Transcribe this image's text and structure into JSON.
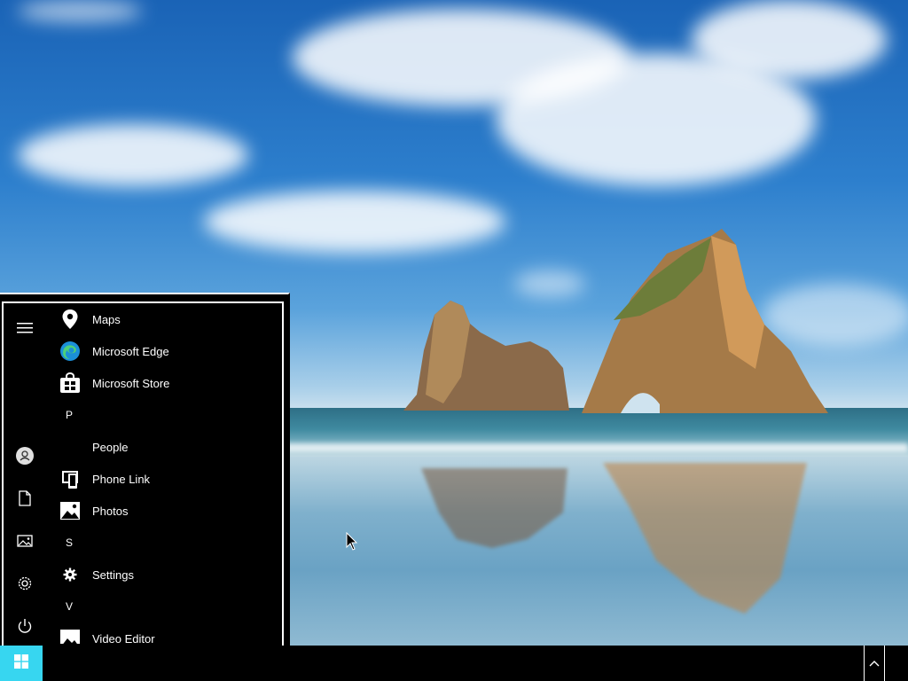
{
  "start_menu": {
    "rail": [
      {
        "name": "menu-hamburger-icon"
      },
      {
        "name": "user-account-icon"
      },
      {
        "name": "documents-icon"
      },
      {
        "name": "pictures-icon"
      },
      {
        "name": "settings-icon"
      },
      {
        "name": "power-icon"
      }
    ],
    "apps": [
      {
        "label": "Maps",
        "icon": "maps-icon"
      },
      {
        "label": "Microsoft Edge",
        "icon": "edge-icon"
      },
      {
        "label": "Microsoft Store",
        "icon": "store-icon"
      },
      {
        "letter": "P"
      },
      {
        "label": "People",
        "icon": "people-icon"
      },
      {
        "label": "Phone Link",
        "icon": "phone-link-icon"
      },
      {
        "label": "Photos",
        "icon": "photos-icon"
      },
      {
        "letter": "S"
      },
      {
        "label": "Settings",
        "icon": "settings-app-icon"
      },
      {
        "letter": "V"
      },
      {
        "label": "Video Editor",
        "icon": "video-editor-icon"
      }
    ]
  },
  "taskbar": {
    "start_icon": "windows-logo-icon",
    "tray_icon": "chevron-up-icon",
    "accent": "#37d6f0"
  },
  "colors": {
    "menu_bg": "#000000",
    "menu_text": "#ffffff"
  }
}
